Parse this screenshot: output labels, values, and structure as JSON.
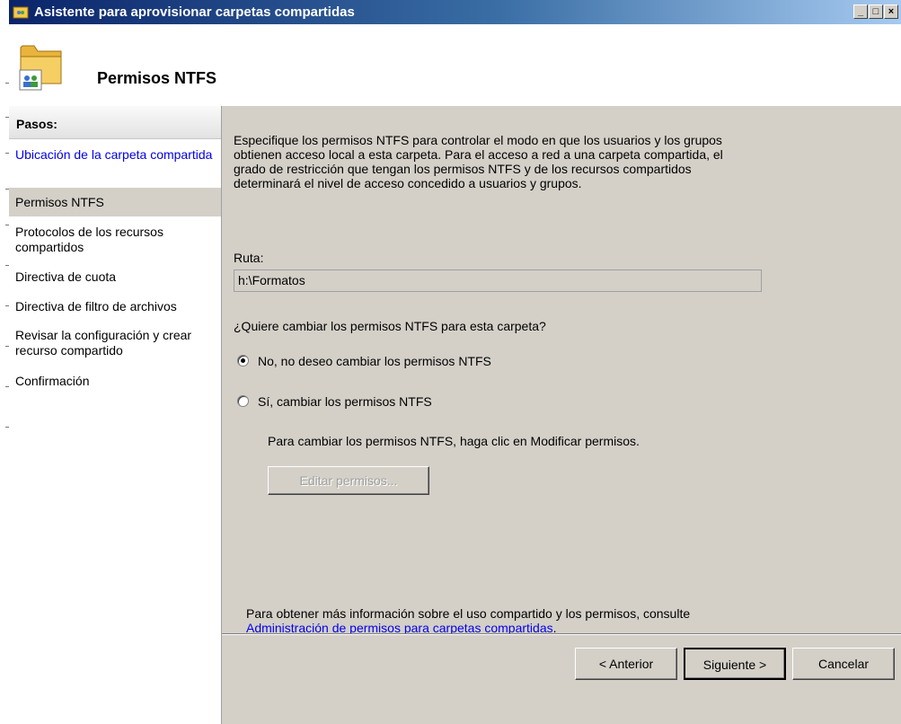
{
  "window": {
    "title": "Asistente para aprovisionar carpetas compartidas",
    "controls": [
      "_",
      "□",
      "×"
    ]
  },
  "header": {
    "title": "Permisos NTFS",
    "icon": "shared-folder-icon"
  },
  "steps": {
    "heading": "Pasos:",
    "items": [
      {
        "label": "Ubicación de la carpeta compartida",
        "state": "link"
      },
      {
        "label": "Permisos NTFS",
        "state": "current"
      },
      {
        "label": "Protocolos de los recursos compartidos",
        "state": "normal"
      },
      {
        "label": "Directiva de cuota",
        "state": "normal"
      },
      {
        "label": "Directiva de filtro de archivos",
        "state": "normal"
      },
      {
        "label": "Revisar la configuración y crear recurso compartido",
        "state": "normal"
      },
      {
        "label": "Confirmación",
        "state": "normal"
      }
    ]
  },
  "content": {
    "intro": "Especifique los permisos NTFS para controlar el modo en que los usuarios y los grupos obtienen acceso local a esta carpeta. Para el acceso a red a una carpeta compartida, el grado de restricción que tengan los permisos NTFS y de los recursos compartidos determinará el nivel de acceso concedido a usuarios y grupos.",
    "path_label": "Ruta:",
    "path_value": "h:\\Formatos",
    "question": "¿Quiere cambiar los permisos NTFS para esta carpeta?",
    "option_no": "No, no deseo cambiar los permisos NTFS",
    "option_yes": "Sí, cambiar los permisos NTFS",
    "selected_option": "no",
    "edit_hint": "Para cambiar los permisos NTFS, haga clic en Modificar permisos.",
    "edit_button": "Editar permisos...",
    "more_info": "Para obtener más información sobre el uso compartido y los permisos, consulte",
    "more_info_link": "Administración de permisos para carpetas compartidas",
    "more_info_end": "."
  },
  "footer": {
    "back": "< Anterior",
    "next": "Siguiente >",
    "cancel": "Cancelar"
  },
  "colors": {
    "titlebar_start": "#0a246a",
    "titlebar_end": "#a6caf0",
    "link": "#0000ee",
    "dialog_face": "#d4d0c8"
  }
}
